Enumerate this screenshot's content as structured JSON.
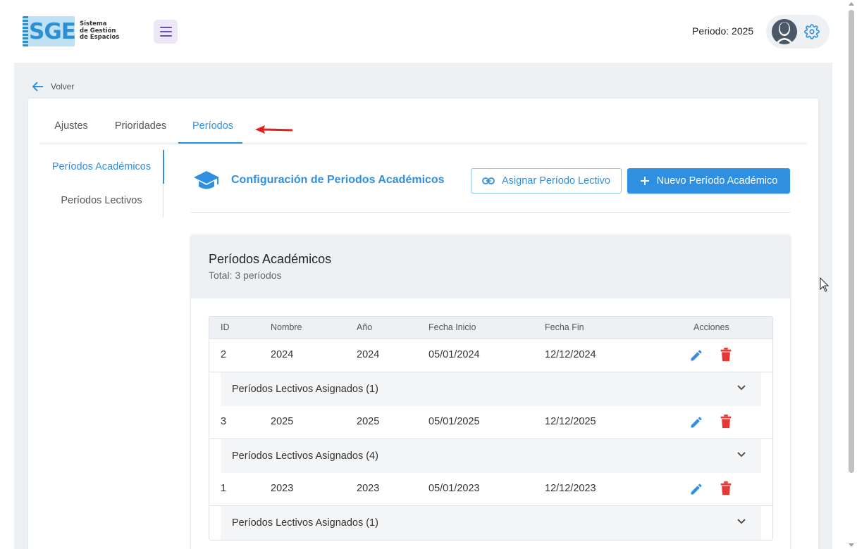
{
  "header": {
    "logo_text": "SGE",
    "logo_sub": [
      "Sistema",
      "de Gestión",
      "de Espacios"
    ],
    "period_label": "Periodo: 2025",
    "icons": {
      "menu": "hamburger-menu-icon",
      "avatar": "user-avatar-icon",
      "settings": "gear-icon"
    }
  },
  "back_label": "Volver",
  "tabs": [
    {
      "label": "Ajustes",
      "active": false
    },
    {
      "label": "Prioridades",
      "active": false
    },
    {
      "label": "Períodos",
      "active": true
    }
  ],
  "sidenav": [
    {
      "label": "Períodos Académicos",
      "active": true
    },
    {
      "label": "Períodos Lectivos",
      "active": false
    }
  ],
  "config": {
    "title": "Configuración de Periodos Académicos",
    "assign_button": "Asignar Período Lectivo",
    "new_button": "Nuevo Período Académico"
  },
  "list": {
    "title": "Períodos Académicos",
    "subtitle": "Total: 3 períodos",
    "columns": [
      "ID",
      "Nombre",
      "Año",
      "Fecha Inicio",
      "Fecha Fin",
      "Acciones"
    ],
    "rows": [
      {
        "id": "2",
        "nombre": "2024",
        "anio": "2024",
        "inicio": "05/01/2024",
        "fin": "12/12/2024",
        "lectivos": "Períodos Lectivos Asignados (1)"
      },
      {
        "id": "3",
        "nombre": "2025",
        "anio": "2025",
        "inicio": "05/01/2025",
        "fin": "12/12/2025",
        "lectivos": "Períodos Lectivos Asignados (4)"
      },
      {
        "id": "1",
        "nombre": "2023",
        "anio": "2023",
        "inicio": "05/01/2023",
        "fin": "12/12/2023",
        "lectivos": "Períodos Lectivos Asignados (1)"
      }
    ]
  },
  "colors": {
    "accent": "#2f8fe0",
    "danger": "#e53935",
    "annotation": "#e0201a"
  }
}
